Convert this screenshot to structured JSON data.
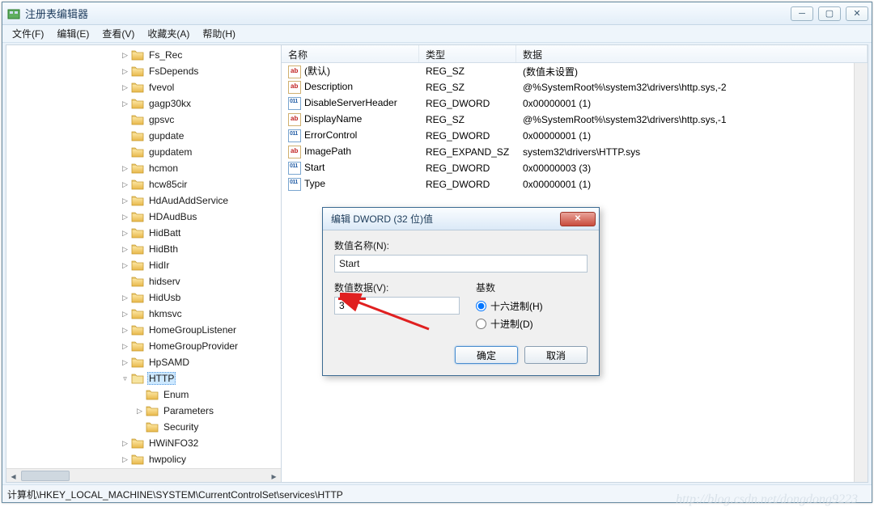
{
  "window": {
    "title": "注册表编辑器"
  },
  "menu": {
    "file": "文件(F)",
    "edit": "编辑(E)",
    "view": "查看(V)",
    "fav": "收藏夹(A)",
    "help": "帮助(H)"
  },
  "tree": {
    "items": [
      {
        "indent": 3,
        "exp": "▷",
        "label": "Fs_Rec"
      },
      {
        "indent": 3,
        "exp": "▷",
        "label": "FsDepends"
      },
      {
        "indent": 3,
        "exp": "▷",
        "label": "fvevol"
      },
      {
        "indent": 3,
        "exp": "▷",
        "label": "gagp30kx"
      },
      {
        "indent": 3,
        "exp": "",
        "label": "gpsvc"
      },
      {
        "indent": 3,
        "exp": "",
        "label": "gupdate"
      },
      {
        "indent": 3,
        "exp": "",
        "label": "gupdatem"
      },
      {
        "indent": 3,
        "exp": "▷",
        "label": "hcmon"
      },
      {
        "indent": 3,
        "exp": "▷",
        "label": "hcw85cir"
      },
      {
        "indent": 3,
        "exp": "▷",
        "label": "HdAudAddService"
      },
      {
        "indent": 3,
        "exp": "▷",
        "label": "HDAudBus"
      },
      {
        "indent": 3,
        "exp": "▷",
        "label": "HidBatt"
      },
      {
        "indent": 3,
        "exp": "▷",
        "label": "HidBth"
      },
      {
        "indent": 3,
        "exp": "▷",
        "label": "HidIr"
      },
      {
        "indent": 3,
        "exp": "",
        "label": "hidserv"
      },
      {
        "indent": 3,
        "exp": "▷",
        "label": "HidUsb"
      },
      {
        "indent": 3,
        "exp": "▷",
        "label": "hkmsvc"
      },
      {
        "indent": 3,
        "exp": "▷",
        "label": "HomeGroupListener"
      },
      {
        "indent": 3,
        "exp": "▷",
        "label": "HomeGroupProvider"
      },
      {
        "indent": 3,
        "exp": "▷",
        "label": "HpSAMD"
      },
      {
        "indent": 3,
        "exp": "▿",
        "label": "HTTP",
        "selected": true,
        "open": true
      },
      {
        "indent": 4,
        "exp": "",
        "label": "Enum"
      },
      {
        "indent": 4,
        "exp": "▷",
        "label": "Parameters"
      },
      {
        "indent": 4,
        "exp": "",
        "label": "Security"
      },
      {
        "indent": 3,
        "exp": "▷",
        "label": "HWiNFO32"
      },
      {
        "indent": 3,
        "exp": "▷",
        "label": "hwpolicy"
      }
    ]
  },
  "list": {
    "headers": {
      "name": "名称",
      "type": "类型",
      "data": "数据"
    },
    "rows": [
      {
        "icon": "sz",
        "name": "(默认)",
        "type": "REG_SZ",
        "data": "(数值未设置)"
      },
      {
        "icon": "sz",
        "name": "Description",
        "type": "REG_SZ",
        "data": "@%SystemRoot%\\system32\\drivers\\http.sys,-2"
      },
      {
        "icon": "dw",
        "name": "DisableServerHeader",
        "type": "REG_DWORD",
        "data": "0x00000001 (1)"
      },
      {
        "icon": "sz",
        "name": "DisplayName",
        "type": "REG_SZ",
        "data": "@%SystemRoot%\\system32\\drivers\\http.sys,-1"
      },
      {
        "icon": "dw",
        "name": "ErrorControl",
        "type": "REG_DWORD",
        "data": "0x00000001 (1)"
      },
      {
        "icon": "sz",
        "name": "ImagePath",
        "type": "REG_EXPAND_SZ",
        "data": "system32\\drivers\\HTTP.sys"
      },
      {
        "icon": "dw",
        "name": "Start",
        "type": "REG_DWORD",
        "data": "0x00000003 (3)"
      },
      {
        "icon": "dw",
        "name": "Type",
        "type": "REG_DWORD",
        "data": "0x00000001 (1)"
      }
    ]
  },
  "dialog": {
    "title": "编辑 DWORD (32 位)值",
    "name_label": "数值名称(N):",
    "name_value": "Start",
    "data_label": "数值数据(V):",
    "data_value": "3",
    "base_label": "基数",
    "hex_label": "十六进制(H)",
    "dec_label": "十进制(D)",
    "ok": "确定",
    "cancel": "取消"
  },
  "status": {
    "path": "计算机\\HKEY_LOCAL_MACHINE\\SYSTEM\\CurrentControlSet\\services\\HTTP"
  },
  "watermark": "http://blog.csdn.net/dongdong9223"
}
